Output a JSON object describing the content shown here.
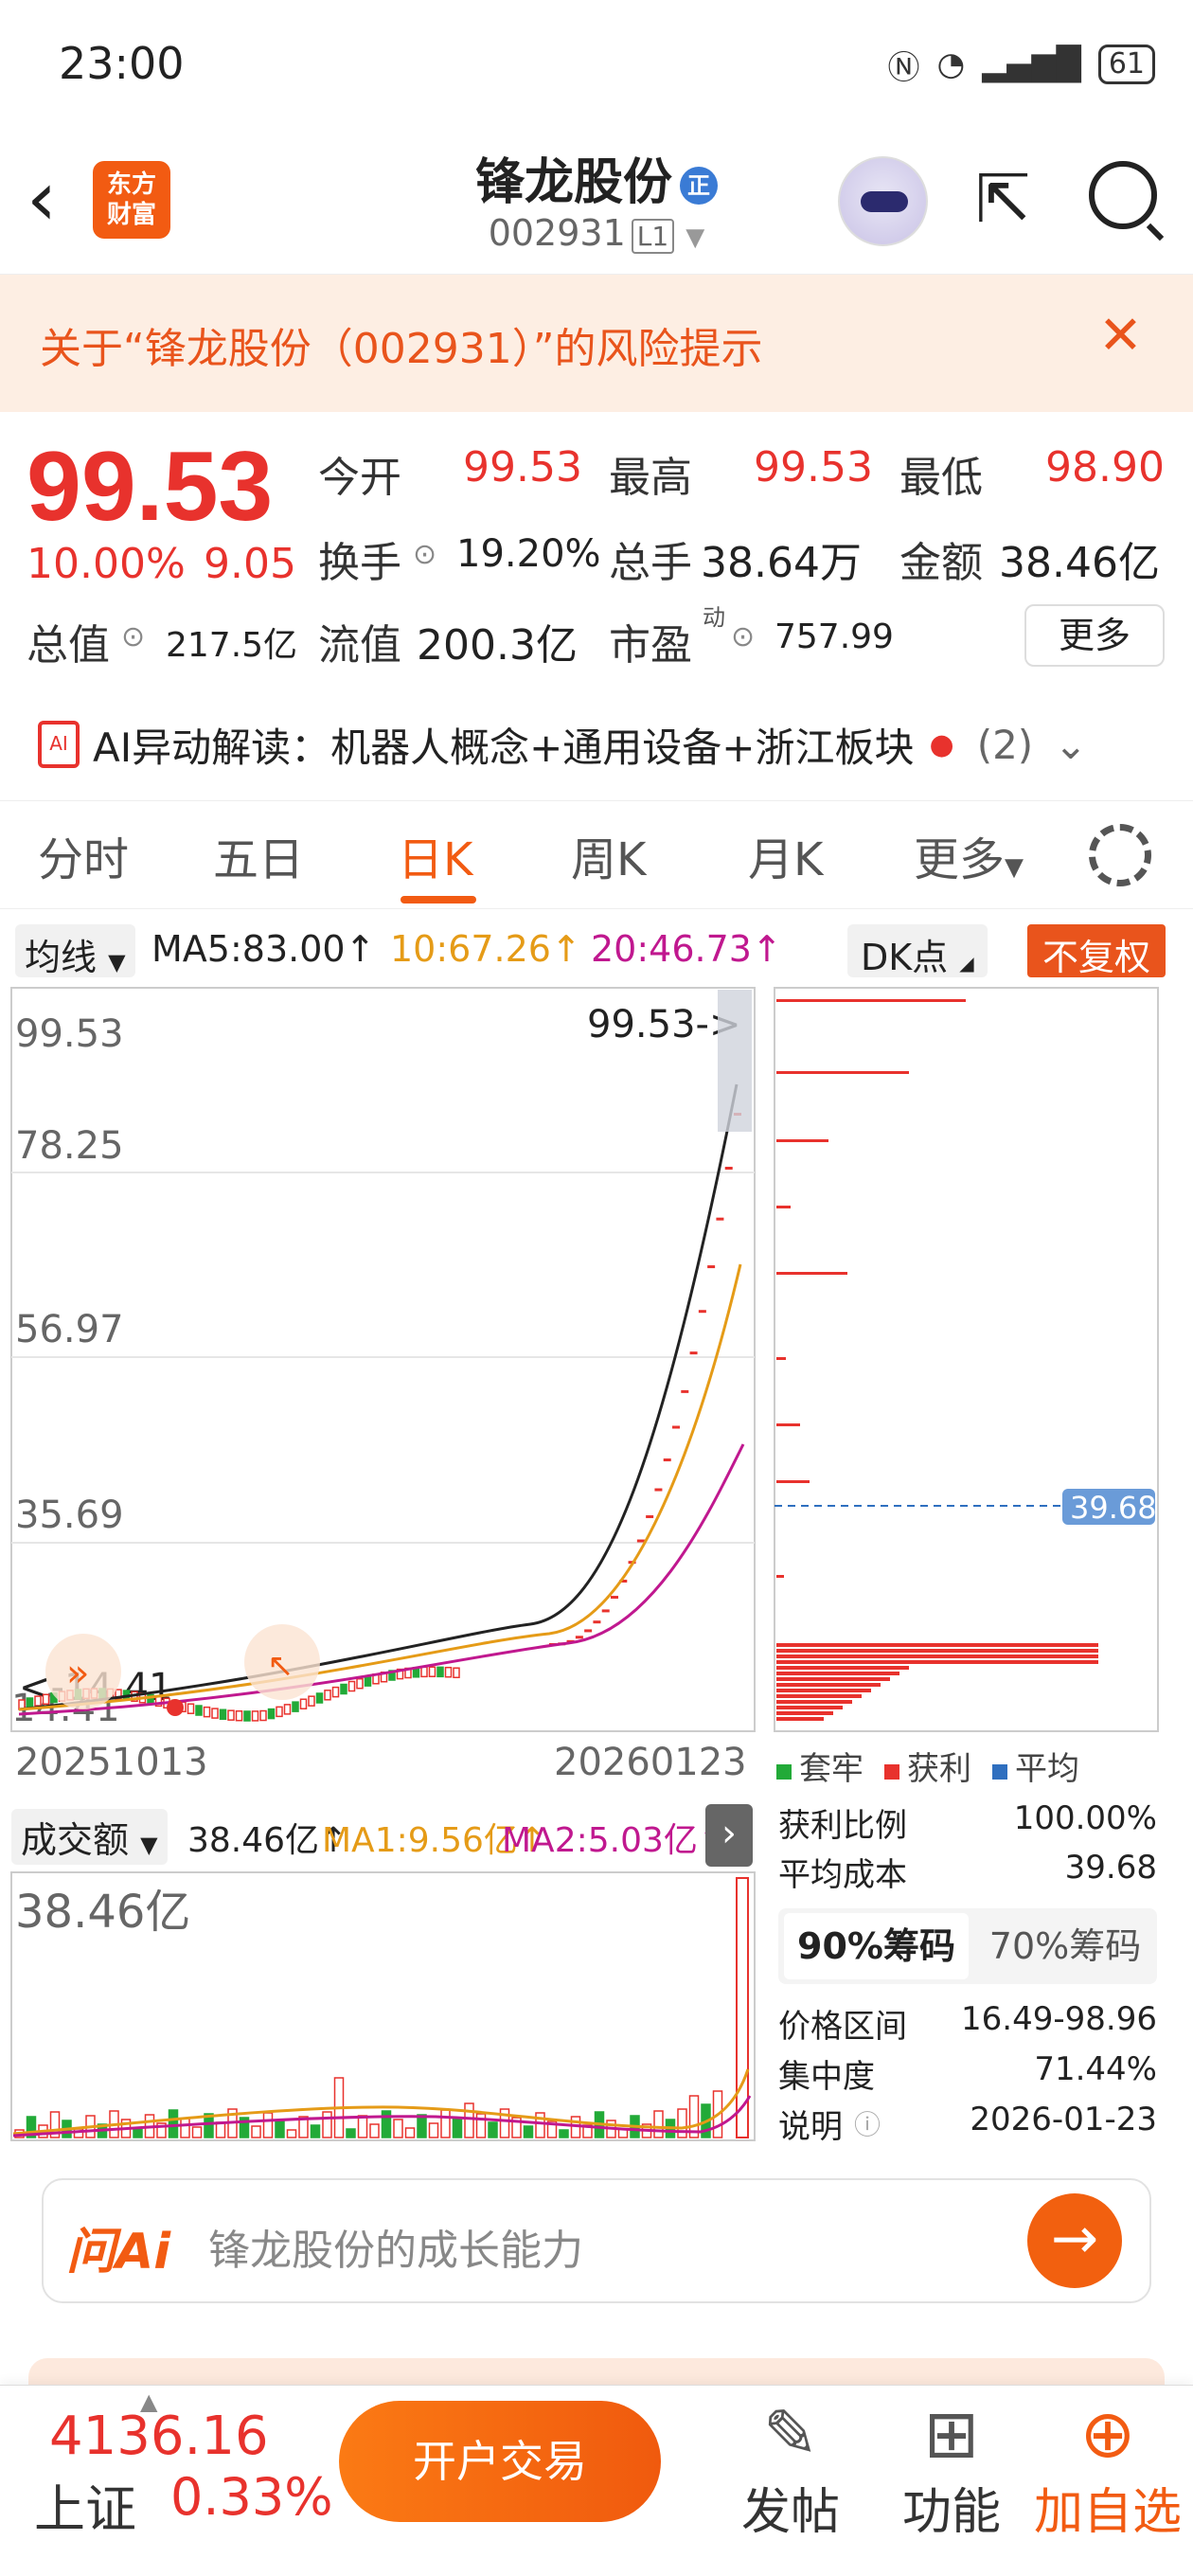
{
  "status_bar": {
    "time": "23:00",
    "battery": "61"
  },
  "nav": {
    "logo_text": "东方\n财富",
    "title": "锋龙股份",
    "title_badge": "正",
    "code": "002931",
    "level_badge": "L1"
  },
  "risk_banner": {
    "text": "关于“锋龙股份（002931）”的风险提示"
  },
  "quote": {
    "price": "99.53",
    "change_pct": "10.00%",
    "change": "9.05",
    "open_label": "今开",
    "open": "99.53",
    "high_label": "最高",
    "high": "99.53",
    "low_label": "最低",
    "low": "98.90",
    "turnover_label": "换手",
    "turnover": "19.20%",
    "volume_label": "总手",
    "volume": "38.64万",
    "amount_label": "金额",
    "amount": "38.46亿",
    "mktcap_label": "总值",
    "mktcap": "217.5亿",
    "float_label": "流值",
    "float": "200.3亿",
    "pe_label": "市盈",
    "pe_sup": "动",
    "pe": "757.99",
    "more_label": "更多"
  },
  "ai_bar": {
    "icon_text": "AI",
    "text": "AI异动解读：机器人概念+通用设备+浙江板块",
    "count": "(2)"
  },
  "tabs": [
    "分时",
    "五日",
    "日K",
    "周K",
    "月K",
    "更多"
  ],
  "active_tab": "日K",
  "ma_bar": {
    "selector": "均线",
    "ma5": "MA5:83.00↑",
    "ma10": "10:67.26↑",
    "ma20": "20:46.73↑",
    "dk": "DK点",
    "adjust": "不复权"
  },
  "kchart": {
    "y_ticks": [
      "99.53",
      "78.25",
      "56.97",
      "35.69"
    ],
    "max_label": "99.53->",
    "min_label": "<-14.41",
    "min_tick": "14.41",
    "start_date": "20251013",
    "end_date": "20260123"
  },
  "chips": {
    "avg_cost_label": "39.68",
    "legend": [
      "套牢",
      "获利",
      "平均"
    ],
    "profit_ratio_label": "获利比例",
    "profit_ratio": "100.00%",
    "avg_cost_text_label": "平均成本",
    "avg_cost": "39.68",
    "tab90": "90%筹码",
    "tab70": "70%筹码",
    "range_label": "价格区间",
    "range": "16.49-98.96",
    "concentration_label": "集中度",
    "concentration": "71.44%",
    "note_label": "说明",
    "note_date": "2026-01-23"
  },
  "volume_bar": {
    "selector": "成交额",
    "value": "38.46亿↑",
    "ma1": "MA1:9.56亿↑",
    "ma2": "MA2:5.03亿↑",
    "max_label": "38.46亿"
  },
  "ask_ai": {
    "logo": "问Ai",
    "placeholder": "锋龙股份的成长能力"
  },
  "bottom": {
    "index_value": "4136.16",
    "index_name": "上证",
    "index_pct": "0.33%",
    "open_account": "开户交易",
    "post": "发帖",
    "functions": "功能",
    "add_watch": "加自选"
  },
  "colors": {
    "up": "#e8322d",
    "brand": "#f25b12",
    "ma10": "#e59b17",
    "ma20": "#c0188f",
    "down": "#22aa38"
  }
}
